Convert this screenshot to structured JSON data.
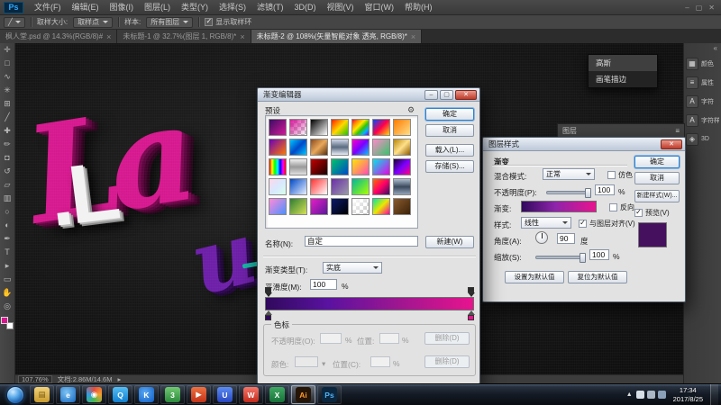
{
  "window": {
    "logo": "Ps",
    "menus": [
      "文件(F)",
      "编辑(E)",
      "图像(I)",
      "图层(L)",
      "类型(Y)",
      "选择(S)",
      "滤镜(T)",
      "3D(D)",
      "视图(V)",
      "窗口(W)",
      "帮助(H)"
    ],
    "controls": [
      "–",
      "▢",
      "✕"
    ]
  },
  "options_bar": {
    "tool_glyph": "╱",
    "fields": [
      {
        "label": "取样大小:",
        "value": "取样点"
      },
      {
        "label": "样本:",
        "value": "所有图层"
      }
    ],
    "checkbox_label": "显示取样环",
    "checkbox_checked": true
  },
  "tabs": [
    {
      "label": "枫人堂.psd @ 14.3%(RGB/8)#",
      "active": false
    },
    {
      "label": "未标题-1 @ 32.7%(图层 1, RGB/8)*",
      "active": false
    },
    {
      "label": "未标题-2 @ 108%(矢量智能对象 透亮, RGB/8)*",
      "active": true
    }
  ],
  "tools": [
    {
      "name": "move-tool",
      "glyph": "✛"
    },
    {
      "name": "marquee-tool",
      "glyph": "□"
    },
    {
      "name": "lasso-tool",
      "glyph": "∿"
    },
    {
      "name": "magic-wand-tool",
      "glyph": "✳"
    },
    {
      "name": "crop-tool",
      "glyph": "⊞"
    },
    {
      "name": "eyedropper-tool",
      "glyph": "╱"
    },
    {
      "name": "healing-brush-tool",
      "glyph": "✚"
    },
    {
      "name": "brush-tool",
      "glyph": "✏"
    },
    {
      "name": "clone-stamp-tool",
      "glyph": "◘"
    },
    {
      "name": "history-brush-tool",
      "glyph": "↺"
    },
    {
      "name": "eraser-tool",
      "glyph": "▱"
    },
    {
      "name": "gradient-tool",
      "glyph": "▥"
    },
    {
      "name": "blur-tool",
      "glyph": "○"
    },
    {
      "name": "dodge-tool",
      "glyph": "◐"
    },
    {
      "name": "pen-tool",
      "glyph": "✒"
    },
    {
      "name": "type-tool",
      "glyph": "T"
    },
    {
      "name": "path-select-tool",
      "glyph": "▸"
    },
    {
      "name": "shape-tool",
      "glyph": "▭"
    },
    {
      "name": "hand-tool",
      "glyph": "✋"
    },
    {
      "name": "zoom-tool",
      "glyph": "◎"
    }
  ],
  "canvas": {
    "script_text": "La",
    "script_color": "#d6188f",
    "white_text": ".L",
    "white_color": "#f2f2f2",
    "sub_text": "u",
    "sub_color": "#6d1fa8",
    "accent_color": "#16b8a6"
  },
  "history_popup": {
    "items": [
      "高斯",
      "画笔描边"
    ]
  },
  "layers_panel": {
    "title": "图层",
    "menu_glyph": "≡"
  },
  "gradient_editor": {
    "title": "渐变编辑器",
    "presets_label": "预设",
    "gear_glyph": "⚙",
    "buttons": {
      "ok": "确定",
      "cancel": "取消",
      "load": "载入(L)...",
      "save": "存储(S)..."
    },
    "name_label": "名称(N):",
    "name_value": "自定",
    "new_button": "新建(W)",
    "type_label": "渐变类型(T):",
    "type_value": "实底",
    "smooth_label": "平滑度(M):",
    "smooth_value": "100",
    "percent": "%",
    "gradient_css": "linear-gradient(90deg,#30095c 0%,#5a12a0 30%,#a01690 65%,#e8138e 100%)",
    "stops": [
      {
        "color": "#30095c",
        "pos": "0"
      },
      {
        "color": "#e8138e",
        "pos": "100"
      }
    ],
    "stops_label": "色标",
    "opacity_row": {
      "label": "不透明度(O):",
      "pos_label": "位置:",
      "delete": "删除(D)"
    },
    "color_row": {
      "label": "颜色:",
      "pos_label": "位置(C):",
      "delete": "删除(D)"
    },
    "presets": [
      "linear-gradient(135deg,#3a0d63,#d6189a)",
      "linear-gradient(135deg,#d6189a,rgba(214,24,154,0))",
      "linear-gradient(135deg,#000000,#ffffff)",
      "linear-gradient(135deg,#ff1e00,#ffd800,#21c400)",
      "linear-gradient(135deg,#ff0040,#ff8a00,#ffe600,#35c400,#00b4ff,#7a00ff)",
      "linear-gradient(135deg,#0048ff,#ff004c,#ffd800)",
      "linear-gradient(135deg,#ff7a00,#ffe08a)",
      "linear-gradient(135deg,#6a00b8,#ff7a00)",
      "linear-gradient(135deg,#00c8ff,#0048c8,#00c8ff)",
      "linear-gradient(135deg,#8a4a1e,#e8a85a,#5a2e0c)",
      "linear-gradient(180deg,#cfd8e8,#5a6a80,#e8eef8)",
      "linear-gradient(135deg,#ff00c8,#7a00ff,#00c8ff)",
      "linear-gradient(135deg,#ff8ac8,#35c46a)",
      "linear-gradient(135deg,#b8860b,#ffe08a,#8a5a00)",
      "linear-gradient(90deg,#ff0000,#ffff00,#00ff00,#00ffff,#0000ff,#ff00ff,#ff0000)",
      "linear-gradient(180deg,#f0f0f0,#9a9a9a,#e0e0e0)",
      "linear-gradient(135deg,#c40000,#1a0000)",
      "linear-gradient(135deg,#00c46a,#0048c8)",
      "linear-gradient(135deg,#ffe600,#ff4ab8)",
      "linear-gradient(135deg,#00e8e8,#e800e8)",
      "linear-gradient(135deg,#1a0033,#7a00ff,#ff0080)",
      "linear-gradient(135deg,#ffd8e8,#d8e8ff,#d8ffe8)",
      "linear-gradient(135deg,#0048c8,#e8f0ff)",
      "linear-gradient(135deg,#ff3030,#ffffff)",
      "linear-gradient(135deg,#6a2ea8,#9a9aa8)",
      "linear-gradient(135deg,#00b89a,#aaff00)",
      "linear-gradient(135deg,#ff6a00,#ff0066,#3a0d63)",
      "linear-gradient(180deg,#aebcd0,#3c4a5e,#92a2b8)",
      "linear-gradient(135deg,#ff8ad8,#4a90ff)",
      "linear-gradient(135deg,#2e7d32,#d4e157)",
      "linear-gradient(135deg,#e81ec8,#5a189a)",
      "linear-gradient(135deg,#0a1a6a,#000000)",
      "linear-gradient(135deg,#ffffff,rgba(255,255,255,0))",
      "linear-gradient(135deg,#00e8a0,#e8e800,#ff00a0)",
      "linear-gradient(135deg,#8a5a2e,#3a2208)"
    ]
  },
  "layer_style": {
    "title": "图层样式",
    "section": "渐变",
    "blend_label": "混合模式:",
    "blend_value": "正常",
    "dither": "仿色",
    "opacity_label": "不透明度(P):",
    "opacity_value": "100",
    "percent": "%",
    "gradient_label": "渐变:",
    "reverse": "反向",
    "style_label": "样式:",
    "style_value": "线性",
    "align": "与图层对齐(V)",
    "angle_label": "角度(A):",
    "angle_value": "90",
    "angle_unit": "度",
    "scale_label": "缩放(S):",
    "scale_value": "100",
    "set_default": "设置为默认值",
    "reset_default": "复位为默认值",
    "ok": "确定",
    "cancel": "取消",
    "new_style": "新建样式(W)...",
    "preview": "预览(V)",
    "swatch_color": "#45105e",
    "gradient_css": "linear-gradient(90deg,#30095c,#8e24aa 45%,#e8138e)"
  },
  "right_dock": {
    "collapse_glyph": "«",
    "items": [
      {
        "name": "color-panel",
        "glyph": "▦",
        "label": "颜色"
      },
      {
        "name": "properties-panel",
        "glyph": "≡",
        "label": "属性"
      },
      {
        "name": "character-panel",
        "glyph": "A",
        "label": "字符"
      },
      {
        "name": "character-styles-panel",
        "glyph": "A",
        "label": "字符样式"
      },
      {
        "name": "3d-panel",
        "glyph": "◈",
        "label": "3D"
      }
    ]
  },
  "status_bar": {
    "zoom": "107.76%",
    "doc_info": "文档:2.86M/14.6M",
    "arrow": "▸"
  },
  "taskbar": {
    "icons": [
      {
        "name": "file-explorer",
        "glyph": "▤",
        "bg": "linear-gradient(#f2d27a,#c99b2e)",
        "fg": "#7a5c12"
      },
      {
        "name": "internet-explorer",
        "glyph": "e",
        "bg": "radial-gradient(circle at 40% 35%,#7cc4f4,#1766be)",
        "fg": "#ffffff"
      },
      {
        "name": "media-player",
        "glyph": "◉",
        "bg": "conic-gradient(#e84a3c,#f0a030,#46b84e,#2f9fe8,#e84a3c)",
        "fg": "#ffffff"
      },
      {
        "name": "qq",
        "glyph": "Q",
        "bg": "linear-gradient(#56bdf2,#0f7fd0)",
        "fg": "#ffffff"
      },
      {
        "name": "kugou-music",
        "glyph": "K",
        "bg": "radial-gradient(circle at 40% 35%,#58a8f2,#0f5cc4)",
        "fg": "#ffffff"
      },
      {
        "name": "360-browser",
        "glyph": "3",
        "bg": "linear-gradient(#72c872,#2b8a3c)",
        "fg": "#ffffff"
      },
      {
        "name": "video-player",
        "glyph": "▶",
        "bg": "linear-gradient(#ef7242,#c23318)",
        "fg": "#ffffff"
      },
      {
        "name": "uc-browser",
        "glyph": "U",
        "bg": "linear-gradient(#5c8cf2,#2746c0)",
        "fg": "#ffffff"
      },
      {
        "name": "wps",
        "glyph": "W",
        "bg": "linear-gradient(#f4766a,#c22a1a)",
        "fg": "#ffffff"
      },
      {
        "name": "excel",
        "glyph": "X",
        "bg": "linear-gradient(#3fa862,#17713a)",
        "fg": "#ffffff"
      },
      {
        "name": "illustrator",
        "glyph": "Ai",
        "bg": "#241507",
        "fg": "#ff9a2e",
        "active": true
      },
      {
        "name": "photoshop",
        "glyph": "Ps",
        "bg": "#0b2740",
        "fg": "#53b2f2"
      }
    ],
    "tray_icons": [
      {
        "name": "ime-icon",
        "color": "#d8dee6"
      },
      {
        "name": "volume-icon",
        "color": "#aab6c4"
      },
      {
        "name": "network-icon",
        "color": "#8aa0b8"
      }
    ],
    "tray_up_glyph": "▲",
    "time": "17:34",
    "date": "2017/8/25"
  }
}
